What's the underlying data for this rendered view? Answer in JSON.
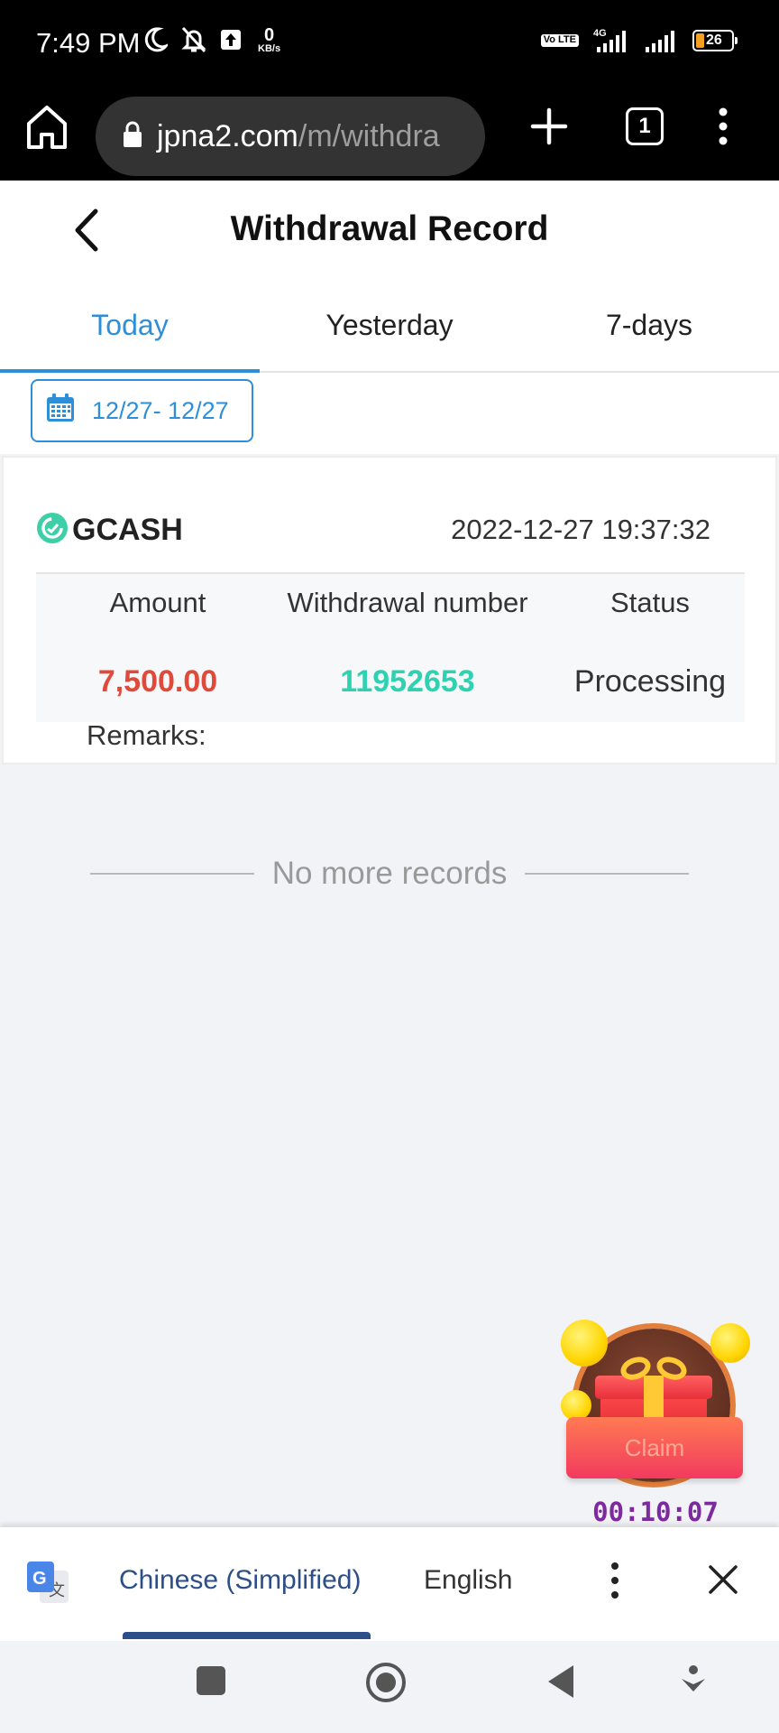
{
  "status_bar": {
    "time": "7:49 PM",
    "net_speed_value": "0",
    "net_speed_unit": "KB/s",
    "volte": "Vo LTE",
    "network_type": "4G",
    "battery_level": "26",
    "battery_color": "#f4a020"
  },
  "browser": {
    "url_host": "jpna2.com",
    "url_path": "/m/withdra",
    "tab_count": "1"
  },
  "header": {
    "title": "Withdrawal Record"
  },
  "tabs": [
    {
      "label": "Today",
      "active": true
    },
    {
      "label": "Yesterday",
      "active": false
    },
    {
      "label": "7-days",
      "active": false
    }
  ],
  "date_filter": {
    "range": "12/27- 12/27"
  },
  "record": {
    "method": "GCASH",
    "datetime": "2022-12-27 19:37:32",
    "columns": [
      "Amount",
      "Withdrawal number",
      "Status"
    ],
    "amount": "7,500.00",
    "withdrawal_number": "11952653",
    "status": "Processing",
    "remarks_label": "Remarks:"
  },
  "no_more_text": "No more records",
  "claim_widget": {
    "button_label": "Claim",
    "timer": "00:10:07"
  },
  "translate_bar": {
    "source_language": "Chinese (Simplified)",
    "target_language": "English"
  },
  "colors": {
    "accent": "#2e8fd8",
    "amount": "#e04a3a",
    "withdrawal_number": "#2ed1b0",
    "translate_blue": "#2c4f8a"
  }
}
